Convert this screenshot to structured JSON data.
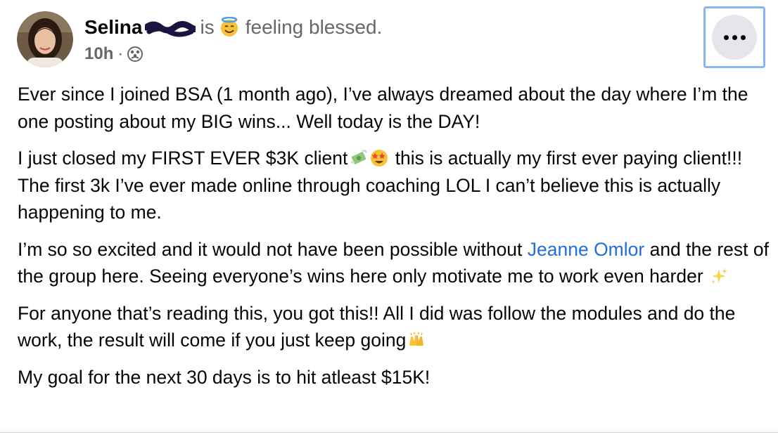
{
  "author": {
    "name": "Selina",
    "is_text": "is",
    "feeling": "feeling blessed.",
    "feeling_icon": "halo-smile-emoji"
  },
  "post_meta": {
    "time": "10h",
    "separator": "·",
    "audience_icon": "group-audience-icon"
  },
  "more_button": {
    "icon": "more-horizontal-icon"
  },
  "content": {
    "p1": "Ever since I joined BSA (1 month ago), I’ve always dreamed about the day where I’m the one posting about my BIG wins... Well today is the DAY!",
    "p2_before": "I just closed my FIRST EVER $3K client",
    "p2_after": " this is actually my first ever paying client!!! The first 3k I’ve ever made online through coaching LOL I can’t believe this is actually happening to me.",
    "p3_before": "I’m so so excited and it would not have been possible without ",
    "p3_mention": "Jeanne Omlor",
    "p3_after": " and the rest of the group here. Seeing everyone’s wins here only motivate me to work even harder ",
    "p4": "For anyone that’s reading this, you got this!! All I did was follow the modules and do the work, the result will come if you just keep going",
    "p5": "My goal for the next 30 days is to hit atleast $15K!"
  },
  "colors": {
    "mention": "#216fdb",
    "secondary_text": "#65676b",
    "button_bg": "#e4e6eb",
    "focus_ring": "#8ab4f8"
  }
}
